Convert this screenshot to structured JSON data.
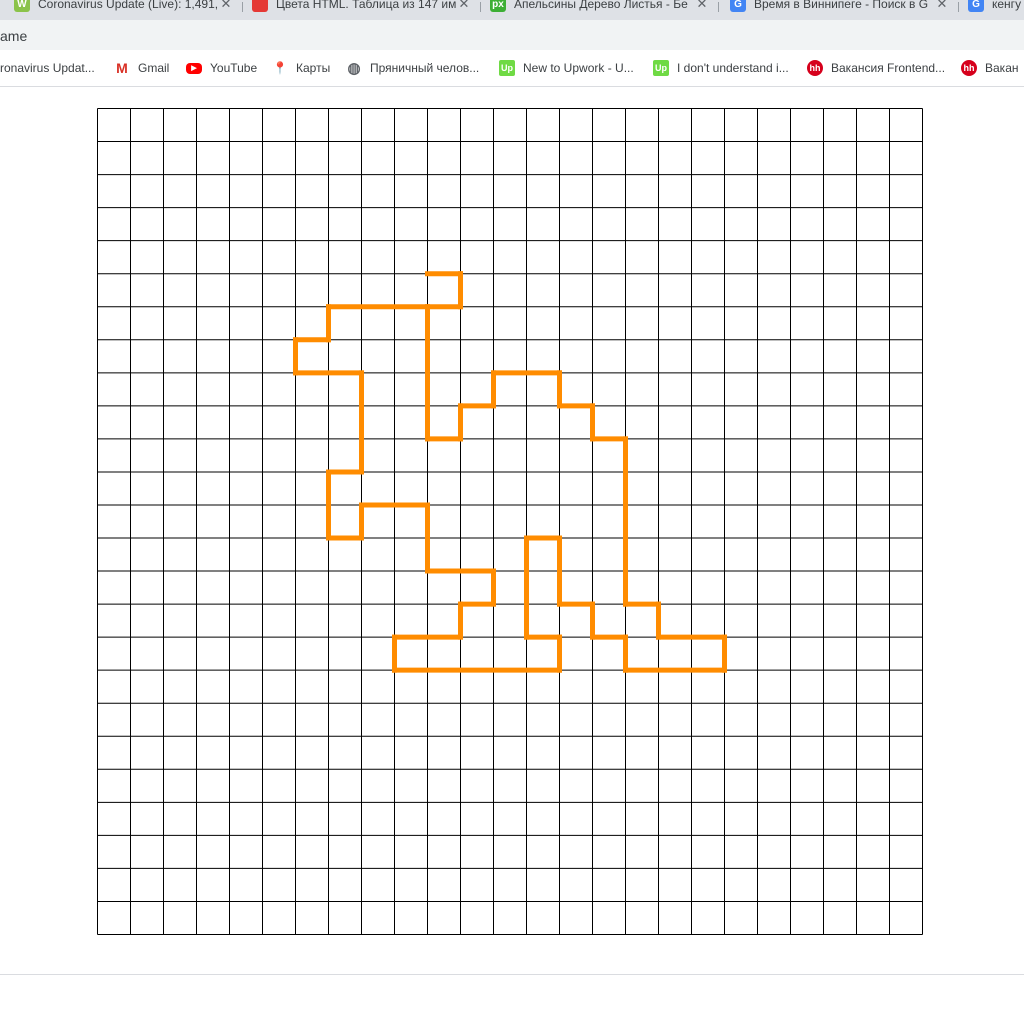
{
  "tabs": [
    {
      "title": "Coronavirus Update (Live): 1,491,",
      "icon": "worldometer-icon",
      "color": "#8bc34a",
      "glyph": "W"
    },
    {
      "title": "Цвета HTML. Таблица из 147 им",
      "icon": "color-wheel-icon",
      "color": "#e53935",
      "glyph": ""
    },
    {
      "title": "Апельсины Дерево Листья - Бе",
      "icon": "pixabay-icon",
      "color": "#3daf35",
      "glyph": "px"
    },
    {
      "title": "Время в Виннипеге - Поиск в G",
      "icon": "google-icon",
      "color": "#4285f4",
      "glyph": "G"
    },
    {
      "title": "кенгу",
      "icon": "google-icon",
      "color": "#4285f4",
      "glyph": "G"
    }
  ],
  "address": {
    "url": "ame"
  },
  "bookmarks": [
    {
      "label": "ronavirus Updat...",
      "icon": "worldometer-icon",
      "color": "",
      "glyph": ""
    },
    {
      "label": "Gmail",
      "icon": "gmail-icon",
      "color": "#d93025",
      "glyph": "M"
    },
    {
      "label": "YouTube",
      "icon": "youtube-icon",
      "color": "#ff0000",
      "glyph": "▶"
    },
    {
      "label": "Карты",
      "icon": "maps-pin-icon",
      "color": "#34a853",
      "glyph": "●"
    },
    {
      "label": "Пряничный челов...",
      "icon": "globe-icon",
      "color": "#5f6368",
      "glyph": "◍"
    },
    {
      "label": "New to Upwork - U...",
      "icon": "upwork-icon",
      "color": "#6fda44",
      "glyph": "Up"
    },
    {
      "label": "I don't understand i...",
      "icon": "upwork-icon",
      "color": "#6fda44",
      "glyph": "Up"
    },
    {
      "label": "Вакансия Frontend...",
      "icon": "hh-icon",
      "color": "#d6001c",
      "glyph": "hh"
    },
    {
      "label": "Вакан",
      "icon": "hh-icon",
      "color": "#d6001c",
      "glyph": "hh"
    }
  ],
  "game": {
    "grid_cols": 25,
    "grid_rows": 25,
    "grid_line_color": "#000000",
    "path_color": "#ff8c00",
    "shape_edges": [
      [
        10,
        5,
        11,
        5
      ],
      [
        11,
        5,
        11,
        6
      ],
      [
        10,
        6,
        11,
        6
      ],
      [
        7,
        6,
        10,
        6
      ],
      [
        7,
        6,
        7,
        7
      ],
      [
        6,
        7,
        7,
        7
      ],
      [
        6,
        7,
        6,
        8
      ],
      [
        6,
        8,
        8,
        8
      ],
      [
        8,
        8,
        8,
        11
      ],
      [
        7,
        11,
        8,
        11
      ],
      [
        7,
        11,
        7,
        13
      ],
      [
        7,
        13,
        8,
        13
      ],
      [
        8,
        12,
        8,
        13
      ],
      [
        8,
        12,
        10,
        12
      ],
      [
        10,
        12,
        10,
        14
      ],
      [
        10,
        14,
        12,
        14
      ],
      [
        12,
        14,
        12,
        15
      ],
      [
        11,
        15,
        12,
        15
      ],
      [
        11,
        15,
        11,
        16
      ],
      [
        9,
        16,
        11,
        16
      ],
      [
        9,
        16,
        9,
        17
      ],
      [
        9,
        17,
        14,
        17
      ],
      [
        14,
        16,
        14,
        17
      ],
      [
        13,
        16,
        14,
        16
      ],
      [
        13,
        13,
        13,
        16
      ],
      [
        13,
        13,
        14,
        13
      ],
      [
        14,
        13,
        14,
        15
      ],
      [
        14,
        15,
        15,
        15
      ],
      [
        15,
        15,
        15,
        16
      ],
      [
        15,
        16,
        16,
        16
      ],
      [
        16,
        16,
        16,
        17
      ],
      [
        16,
        17,
        19,
        17
      ],
      [
        19,
        16,
        19,
        17
      ],
      [
        17,
        16,
        19,
        16
      ],
      [
        17,
        15,
        17,
        16
      ],
      [
        16,
        15,
        17,
        15
      ],
      [
        16,
        10,
        16,
        15
      ],
      [
        15,
        10,
        16,
        10
      ],
      [
        15,
        9,
        15,
        10
      ],
      [
        14,
        9,
        15,
        9
      ],
      [
        14,
        8,
        14,
        9
      ],
      [
        12,
        8,
        14,
        8
      ],
      [
        12,
        8,
        12,
        9
      ],
      [
        11,
        9,
        12,
        9
      ],
      [
        11,
        9,
        11,
        10
      ],
      [
        10,
        10,
        11,
        10
      ],
      [
        10,
        6,
        10,
        10
      ]
    ]
  }
}
